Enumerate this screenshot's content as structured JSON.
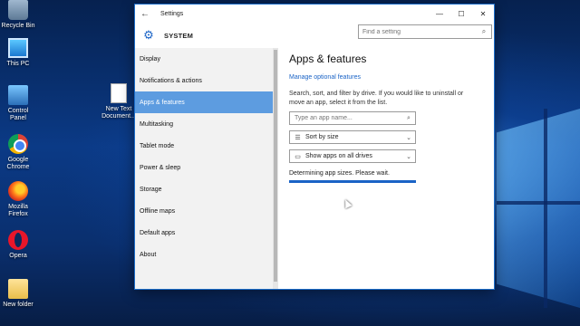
{
  "desktop": {
    "icons": [
      {
        "label": "Recycle Bin",
        "icon": "recycle-bin-icon"
      },
      {
        "label": "This PC",
        "icon": "this-pc-icon"
      },
      {
        "label": "Control Panel",
        "icon": "control-panel-icon"
      },
      {
        "label": "Google Chrome",
        "icon": "chrome-icon"
      },
      {
        "label": "Mozilla Firefox",
        "icon": "firefox-icon"
      },
      {
        "label": "Opera",
        "icon": "opera-icon"
      },
      {
        "label": "New folder",
        "icon": "folder-icon"
      },
      {
        "label": "New Text Document...",
        "icon": "text-document-icon"
      }
    ]
  },
  "window": {
    "title": "Settings",
    "back_icon": "←",
    "minimize_icon": "—",
    "maximize_icon": "☐",
    "close_icon": "✕"
  },
  "header": {
    "section": "SYSTEM",
    "search_placeholder": "Find a setting"
  },
  "sidebar": {
    "items": [
      {
        "label": "Display",
        "active": false
      },
      {
        "label": "Notifications & actions",
        "active": false
      },
      {
        "label": "Apps & features",
        "active": true
      },
      {
        "label": "Multitasking",
        "active": false
      },
      {
        "label": "Tablet mode",
        "active": false
      },
      {
        "label": "Power & sleep",
        "active": false
      },
      {
        "label": "Storage",
        "active": false
      },
      {
        "label": "Offline maps",
        "active": false
      },
      {
        "label": "Default apps",
        "active": false
      },
      {
        "label": "About",
        "active": false
      }
    ]
  },
  "main": {
    "title": "Apps & features",
    "optional_link": "Manage optional features",
    "description": "Search, sort, and filter by drive. If you would like to uninstall or move an app, select it from the list.",
    "search_placeholder": "Type an app name...",
    "sort_label": "Sort by size",
    "filter_label": "Show apps on all drives",
    "status": "Determining app sizes. Please wait.",
    "progress": 1.0
  },
  "colors": {
    "accent": "#1a63c6",
    "nav_active": "#5d9ce0"
  }
}
